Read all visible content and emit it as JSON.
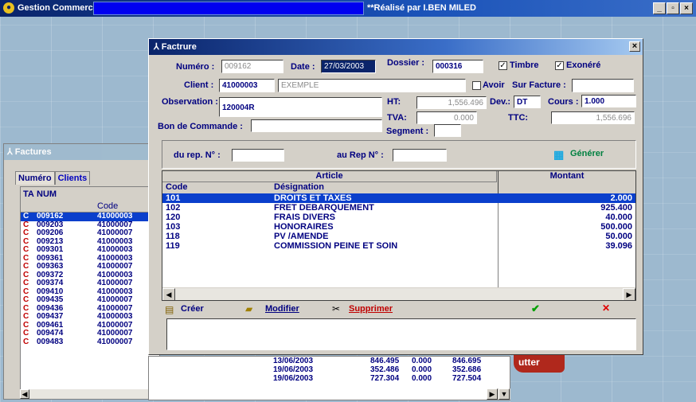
{
  "app": {
    "title": "Gestion Commerciale",
    "credit": "**Réalisé par I.BEN MILED",
    "controls": [
      "_",
      "▫",
      "×"
    ]
  },
  "factures_panel": {
    "title": "Factures",
    "tabs": [
      "Numéro",
      "Clients"
    ],
    "columns": [
      "TA",
      "NUM",
      "Code"
    ],
    "rows": [
      {
        "t": "C",
        "num": "009162",
        "code": "41000003",
        "selected": true
      },
      {
        "t": "C",
        "num": "009203",
        "code": "41000007"
      },
      {
        "t": "C",
        "num": "009206",
        "code": "41000007"
      },
      {
        "t": "C",
        "num": "009213",
        "code": "41000003"
      },
      {
        "t": "C",
        "num": "009301",
        "code": "41000003"
      },
      {
        "t": "C",
        "num": "009361",
        "code": "41000003"
      },
      {
        "t": "C",
        "num": "009363",
        "code": "41000007"
      },
      {
        "t": "C",
        "num": "009372",
        "code": "41000003"
      },
      {
        "t": "C",
        "num": "009374",
        "code": "41000007"
      },
      {
        "t": "C",
        "num": "009410",
        "code": "41000003"
      },
      {
        "t": "C",
        "num": "009435",
        "code": "41000007"
      },
      {
        "t": "C",
        "num": "009436",
        "code": "41000007"
      },
      {
        "t": "C",
        "num": "009437",
        "code": "41000003"
      },
      {
        "t": "C",
        "num": "009461",
        "code": "41000007"
      },
      {
        "t": "C",
        "num": "009474",
        "code": "41000007"
      },
      {
        "t": "C",
        "num": "009483",
        "code": "41000007"
      }
    ]
  },
  "background_table": {
    "rows": [
      {
        "date": "13/06/2003",
        "ht": "846.495",
        "tva": "0.000",
        "ttc": "846.695"
      },
      {
        "date": "19/06/2003",
        "ht": "352.486",
        "tva": "0.000",
        "ttc": "352.686"
      },
      {
        "date": "19/06/2003",
        "ht": "727.304",
        "tva": "0.000",
        "ttc": "727.504"
      }
    ],
    "quit_button": "utter"
  },
  "dialog": {
    "title": "Factrure",
    "close": "×",
    "numero_label": "Numéro :",
    "numero_value": "009162",
    "date_label": "Date :",
    "date_value": "27/03/2003",
    "dossier_label": "Dossier :",
    "dossier_value": "000316",
    "timbre_label": "Timbre",
    "exonere_label": "Exonéré",
    "client_label": "Client :",
    "client_code": "41000003",
    "client_name": "EXEMPLE",
    "avoir_label": "Avoir",
    "sur_facture_label": "Sur Facture :",
    "observation_label": "Observation :",
    "observation_value": "120004R",
    "ht_label": "HT:",
    "ht_value": "1,556.496",
    "dev_label": "Dev.:",
    "dev_value": "DT",
    "cours_label": "Cours :",
    "cours_value": "1.000",
    "tva_label": "TVA:",
    "tva_value": "0.000",
    "ttc_label": "TTC:",
    "ttc_value": "1,556.696",
    "bon_commande_label": "Bon de Commande :",
    "segment_label": "Segment :",
    "du_rep_label": "du rep. N° :",
    "au_rep_label": "au Rep N° :",
    "generer_label": "Générer",
    "article_header": "Article",
    "montant_header": "Montant",
    "code_header": "Code",
    "designation_header": "Désignation",
    "articles": [
      {
        "code": "101",
        "designation": "DROITS ET TAXES",
        "montant": "2.000",
        "selected": true
      },
      {
        "code": "102",
        "designation": "FRET DEBARQUEMENT",
        "montant": "925.400"
      },
      {
        "code": "120",
        "designation": "FRAIS DIVERS",
        "montant": "40.000"
      },
      {
        "code": "103",
        "designation": "HONORAIRES",
        "montant": "500.000"
      },
      {
        "code": "118",
        "designation": "PV /AMENDE",
        "montant": "50.000"
      },
      {
        "code": "119",
        "designation": "COMMISSION PEINE ET SOIN",
        "montant": "39.096"
      }
    ],
    "creer_label": "Créer",
    "modifier_label": "Modifier",
    "supprimer_label": "Supprimer",
    "ok_glyph": "✔",
    "cancel_glyph": "✕"
  }
}
